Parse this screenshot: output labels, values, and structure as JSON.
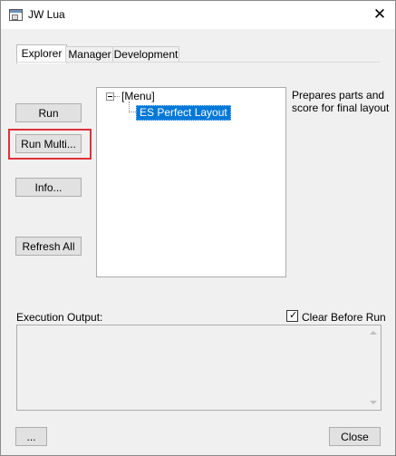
{
  "window": {
    "title": "JW Lua"
  },
  "titlebar": {
    "close_glyph": "✕"
  },
  "tabs": [
    {
      "label": "Explorer",
      "active": true
    },
    {
      "label": "Manager",
      "active": false
    },
    {
      "label": "Development",
      "active": false
    }
  ],
  "buttons": {
    "run": "Run",
    "run_multi": "Run Multi...",
    "info": "Info...",
    "refresh_all": "Refresh All",
    "more": "...",
    "close": "Close"
  },
  "tree": {
    "root": "[Menu]",
    "selected_item": "ES Perfect Layout"
  },
  "description": "Prepares parts and score for final layout",
  "output": {
    "label": "Execution Output:",
    "clear_before_run_label": "Clear Before Run",
    "clear_before_run_checked": true,
    "check_glyph": "✓"
  },
  "icons": [
    "app-icon",
    "close-icon",
    "checkbox-check-icon",
    "scroll-up-arrow-icon",
    "scroll-down-arrow-icon"
  ],
  "colors": {
    "selection": "#0078d7",
    "highlight_box": "#e0313a"
  }
}
